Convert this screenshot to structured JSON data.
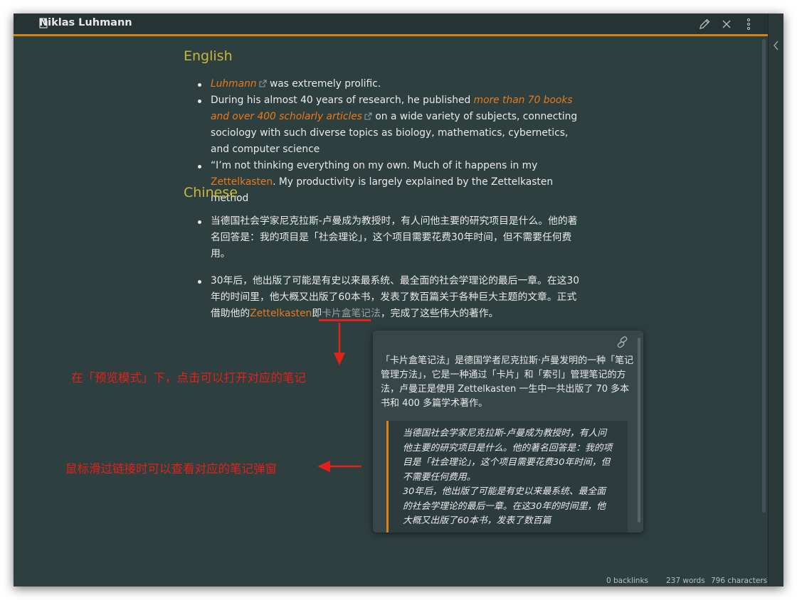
{
  "header": {
    "title": "Niklas Luhmann",
    "icons": [
      "file-icon",
      "pencil-icon",
      "close-icon",
      "more-vertical-icon",
      "chevron-left-icon"
    ]
  },
  "english": {
    "heading": "English",
    "item1": {
      "link": "Luhmann",
      "text": " was extremely prolific."
    },
    "item2": {
      "pre": "During his almost 40 years of research, he published ",
      "link": "more than 70 books and over 400 scholarly articles",
      "post": " on a wide variety of subjects, connecting sociology with such diverse topics as biology, mathematics, cybernetics, and computer science"
    },
    "item3": {
      "pre": "“I’m not thinking everything on my own. Much of it happens in my ",
      "link": "Zettelkasten",
      "post": ". My productivity is largely explained by the Zettelkasten method"
    }
  },
  "chinese": {
    "heading": "Chinese",
    "item1": "当德国社会学家尼克拉斯-卢曼成为教授时，有人问他主要的研究项目是什么。他的著名回答是：我的项目是「社会理论」，这个项目需要花费30年时间，但不需要任何费用。",
    "item2": {
      "pre": "30年后，他出版了可能是有史以来最系统、最全面的社会学理论的最后一章。在这30年的时间里，他大概又出版了60本书，发表了数百篇关于各种巨大主题的文章。正式借助他的",
      "link": "Zettelkasten",
      "mid": "即",
      "hover_link": "卡片盒笔记法",
      "post": "，完成了这些伟大的著作。"
    }
  },
  "popover": {
    "body": "「卡片盒笔记法」是德国学者尼克拉斯·卢曼发明的一种「笔记管理方法」，它是一种通过「卡片」和「索引」管理笔记的方法，卢曼正是使用 Zettelkasten 一生中一共出版了 70 多本书和 400 多篇学术著作。",
    "quote": "当德国社会学家尼克拉斯-卢曼成为教授时，有人问他主要的研究项目是什么。他的著名回答是：我的项目是「社会理论」，这个项目需要花费30年时间，但不需要任何费用。\n30年后，他出版了可能是有史以来最系统、最全面的社会学理论的最后一章。在这30年的时间里，他大概又出版了60本书，发表了数百篇"
  },
  "annotations": {
    "preview_mode": "在「预览模式」下，点击可以打开对应的笔记",
    "hover": "鼠标滑过链接时可以查看对应的笔记弹窗"
  },
  "status": {
    "backlinks": "0 backlinks",
    "words": "237 words",
    "characters": "796 characters"
  },
  "colors": {
    "background": "#2e3f40",
    "accent": "#d8840f",
    "heading": "#c7b53e",
    "link": "#e87a1a",
    "annotation": "#e0221a"
  }
}
